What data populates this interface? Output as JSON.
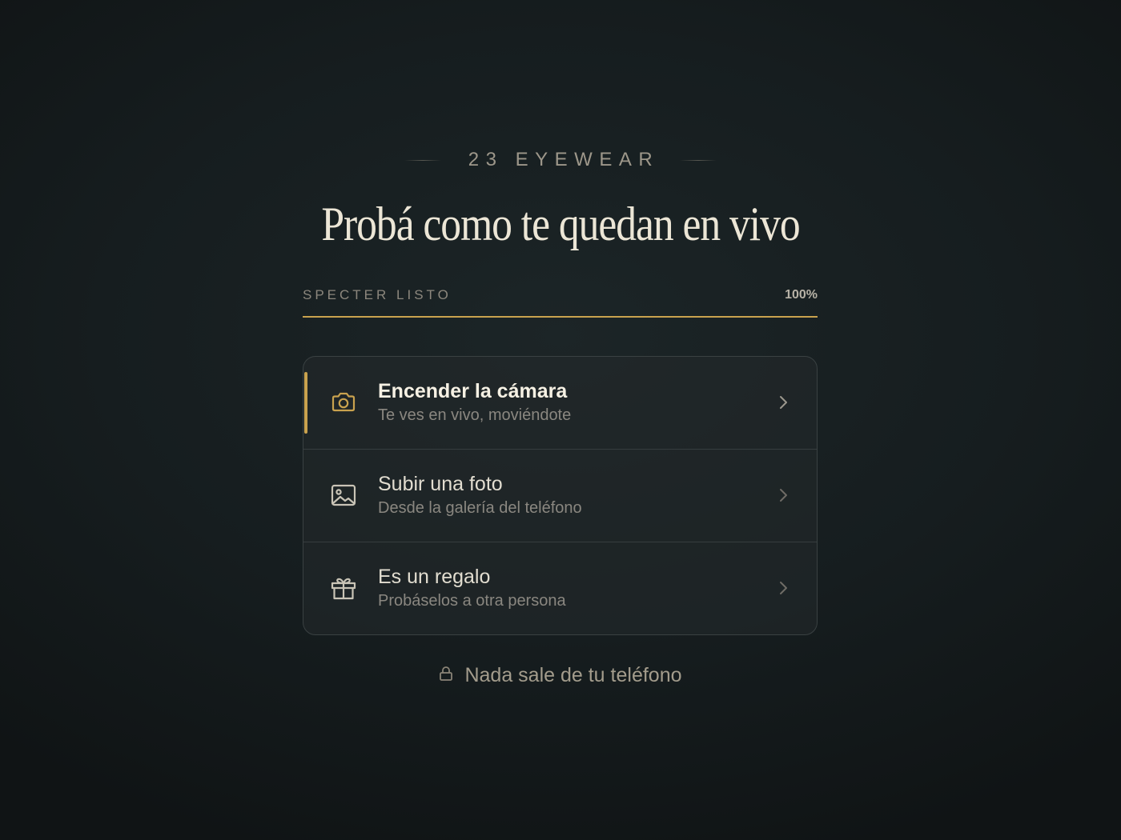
{
  "brand": {
    "name": "23 EYEWEAR"
  },
  "headline": "Probá como te quedan en vivo",
  "progress": {
    "label": "SPECTER LISTO",
    "value_text": "100%",
    "value": 1.0
  },
  "options": [
    {
      "title": "Encender la cámara",
      "subtitle": "Te ves en vivo, moviéndote",
      "icon": "camera-icon",
      "active": true
    },
    {
      "title": "Subir una foto",
      "subtitle": "Desde la galería del teléfono",
      "icon": "image-icon",
      "active": false
    },
    {
      "title": "Es un regalo",
      "subtitle": "Probáselos a otra persona",
      "icon": "gift-icon",
      "active": false
    }
  ],
  "footer": {
    "text": "Nada sale de tu teléfono",
    "icon": "lock-icon"
  },
  "colors": {
    "accent": "#c9a24e",
    "background": "#161d1f",
    "headline": "#ece6d6"
  }
}
